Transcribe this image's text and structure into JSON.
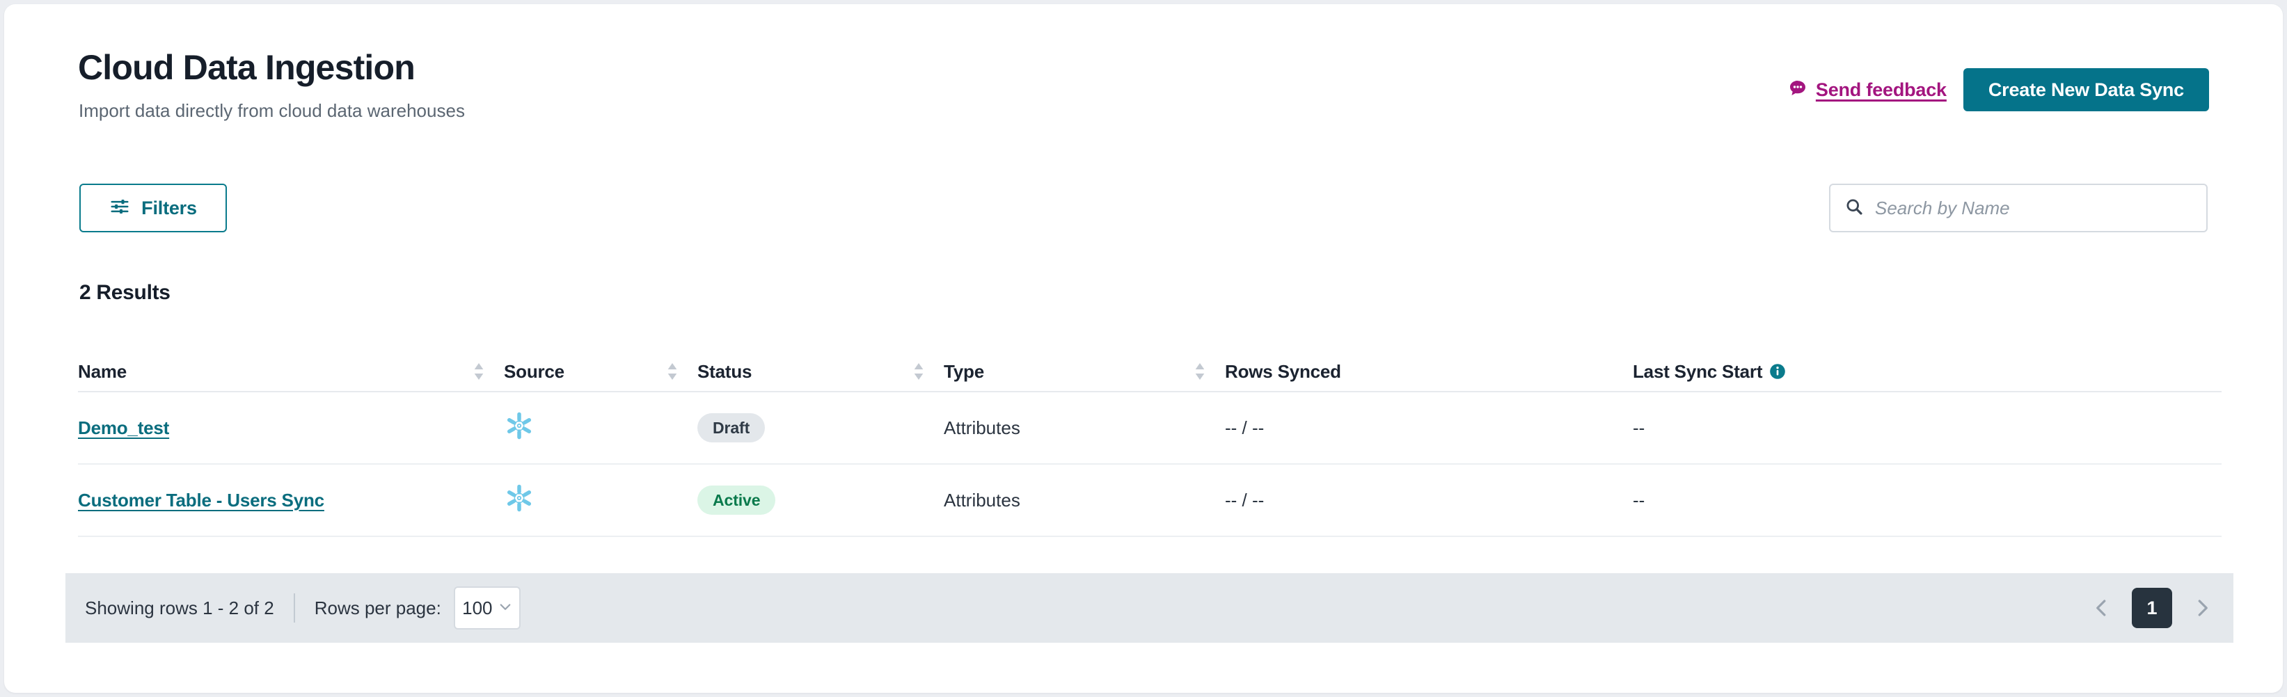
{
  "header": {
    "title": "Cloud Data Ingestion",
    "subtitle": "Import data directly from cloud data warehouses",
    "feedback_label": "Send feedback",
    "create_button_label": "Create New Data Sync"
  },
  "controls": {
    "filters_label": "Filters",
    "search_placeholder": "Search by Name",
    "search_value": ""
  },
  "results": {
    "count_label": "2 Results"
  },
  "table": {
    "columns": [
      {
        "key": "name",
        "label": "Name",
        "sortable": true,
        "info": false
      },
      {
        "key": "source",
        "label": "Source",
        "sortable": true,
        "info": false
      },
      {
        "key": "status",
        "label": "Status",
        "sortable": true,
        "info": false
      },
      {
        "key": "type",
        "label": "Type",
        "sortable": true,
        "info": false
      },
      {
        "key": "rows",
        "label": "Rows Synced",
        "sortable": false,
        "info": false
      },
      {
        "key": "last",
        "label": "Last Sync Start",
        "sortable": false,
        "info": true
      }
    ],
    "rows": [
      {
        "name": "Demo_test",
        "source_icon": "snowflake-icon",
        "status": "Draft",
        "status_variant": "draft",
        "type": "Attributes",
        "rows_synced": "-- / --",
        "last_sync_start": "--"
      },
      {
        "name": "Customer Table - Users Sync",
        "source_icon": "snowflake-icon",
        "status": "Active",
        "status_variant": "active",
        "type": "Attributes",
        "rows_synced": "-- / --",
        "last_sync_start": "--"
      }
    ]
  },
  "footer": {
    "showing_text": "Showing rows 1 - 2 of 2",
    "rows_per_page_label": "Rows per page:",
    "rows_per_page_value": "100",
    "rows_per_page_options": [
      "100"
    ],
    "current_page": "1"
  },
  "colors": {
    "brand_teal": "#05738a",
    "link_teal": "#0a6d7e",
    "feedback_magenta": "#a3157f",
    "badge_active_bg": "#dbf5e6",
    "badge_active_text": "#0a7a4c",
    "badge_draft_bg": "#e3e7eb",
    "badge_draft_text": "#2f3a46",
    "snowflake_blue": "#6fc8e8",
    "footer_bg": "#e4e8ec",
    "page_active_bg": "#27333e"
  }
}
